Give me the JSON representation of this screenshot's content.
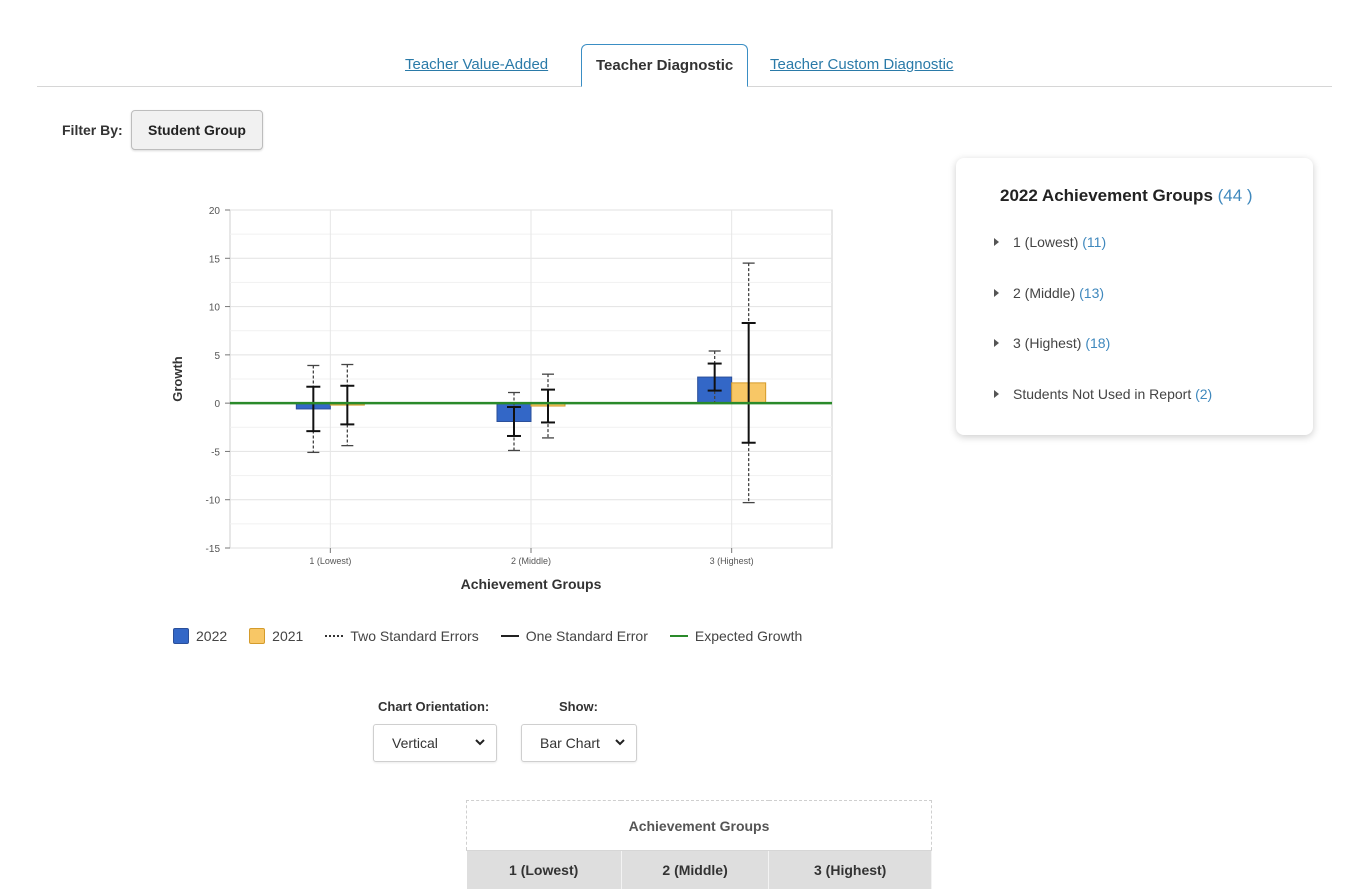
{
  "tabs": [
    {
      "label": "Teacher Value-Added",
      "active": false
    },
    {
      "label": "Teacher Diagnostic",
      "active": true
    },
    {
      "label": "Teacher Custom Diagnostic",
      "active": false
    }
  ],
  "filter": {
    "label": "Filter By:",
    "button": "Student Group"
  },
  "chart_data": {
    "type": "bar",
    "xlabel": "Achievement Groups",
    "ylabel": "Growth",
    "categories": [
      "1 (Lowest)",
      "2 (Middle)",
      "3 (Highest)"
    ],
    "ylim": [
      -15,
      20
    ],
    "yticks": [
      20,
      15,
      10,
      5,
      0,
      -5,
      -10,
      -15
    ],
    "grid": true,
    "expected_growth": 0,
    "series": [
      {
        "name": "2022",
        "color": "#3367c7",
        "values": [
          -0.6,
          -1.9,
          2.7
        ],
        "one_se": [
          2.3,
          1.5,
          1.4
        ],
        "two_se": [
          4.5,
          3.0,
          2.7
        ]
      },
      {
        "name": "2021",
        "color": "#f8c766",
        "values": [
          -0.2,
          -0.3,
          2.1
        ],
        "one_se": [
          2.0,
          1.7,
          6.2
        ],
        "two_se": [
          4.2,
          3.3,
          12.4
        ]
      }
    ],
    "legend_position": "bottom"
  },
  "legend": {
    "y2022": "2022",
    "y2021": "2021",
    "two_se": "Two Standard Errors",
    "one_se": "One Standard Error",
    "expected": "Expected Growth"
  },
  "controls": {
    "orientation_label": "Chart Orientation:",
    "orientation_value": "Vertical",
    "show_label": "Show:",
    "show_value": "Bar Chart"
  },
  "panel": {
    "title": "2022 Achievement Groups",
    "total": "(44 )",
    "items": [
      {
        "label": "1 (Lowest)",
        "count": "(11)"
      },
      {
        "label": "2 (Middle)",
        "count": "(13)"
      },
      {
        "label": "3 (Highest)",
        "count": "(18)"
      },
      {
        "label": "Students Not Used in Report",
        "count": "(2)"
      }
    ]
  },
  "table": {
    "header": "Achievement Groups",
    "columns": [
      "1 (Lowest)",
      "2 (Middle)",
      "3 (Highest)"
    ]
  },
  "colors": {
    "accent": "#3a8ec4",
    "link": "#2a7aa8",
    "expected": "#2a8a2a"
  }
}
